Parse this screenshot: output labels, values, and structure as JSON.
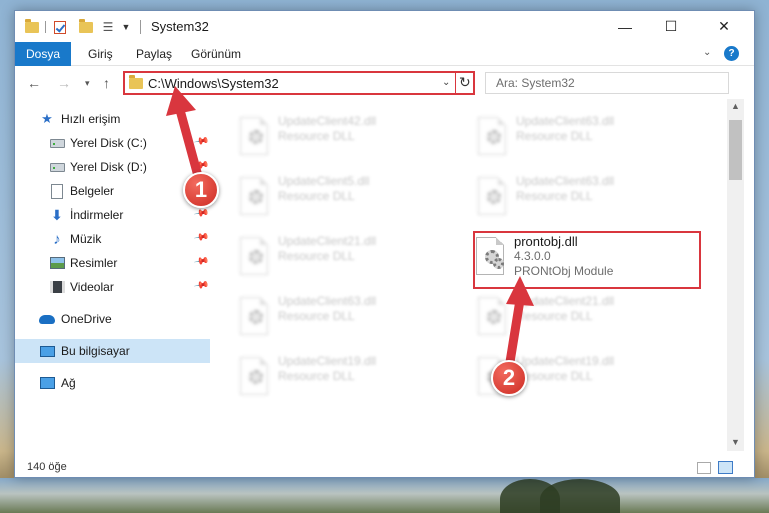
{
  "window": {
    "title": "System32",
    "colors": {
      "accent": "#1979ca",
      "annotation": "#d9363e",
      "selected": "#cce4f7"
    }
  },
  "ribbon": {
    "tabs": [
      "Dosya",
      "Giriş",
      "Paylaş",
      "Görünüm"
    ],
    "help_label": "?"
  },
  "navigation": {
    "address": "C:\\Windows\\System32",
    "search_placeholder": "Ara: System32"
  },
  "sidebar": {
    "items": [
      {
        "label": "Hızlı erişim",
        "icon": "star-icon",
        "pinned": false
      },
      {
        "label": "Yerel Disk (C:)",
        "icon": "drive-icon",
        "pinned": true
      },
      {
        "label": "Yerel Disk (D:)",
        "icon": "drive-icon",
        "pinned": true
      },
      {
        "label": "Belgeler",
        "icon": "document-icon",
        "pinned": true
      },
      {
        "label": "İndirmeler",
        "icon": "download-icon",
        "pinned": true
      },
      {
        "label": "Müzik",
        "icon": "music-icon",
        "pinned": true
      },
      {
        "label": "Resimler",
        "icon": "pictures-icon",
        "pinned": true
      },
      {
        "label": "Videolar",
        "icon": "videos-icon",
        "pinned": true
      },
      {
        "label": "OneDrive",
        "icon": "onedrive-icon",
        "pinned": false
      },
      {
        "label": "Bu bilgisayar",
        "icon": "this-pc-icon",
        "pinned": false,
        "selected": true
      },
      {
        "label": "Ağ",
        "icon": "network-icon",
        "pinned": false
      }
    ]
  },
  "files": [
    {
      "name": "UpdateClient42.dll",
      "type": "Resource DLL",
      "blurred": true
    },
    {
      "name": "UpdateClient63.dll",
      "type": "Resource DLL",
      "blurred": true
    },
    {
      "name": "UpdateClient5.dll",
      "type": "Resource DLL",
      "blurred": true
    },
    {
      "name": "UpdateClient63.dll",
      "type": "Resource DLL",
      "blurred": true
    },
    {
      "name": "UpdateClient21.dll",
      "type": "Resource DLL",
      "blurred": true
    },
    {
      "name": "prontobj.dll",
      "version": "4.3.0.0",
      "type": "PRONtObj Module",
      "blurred": false,
      "highlighted": true
    },
    {
      "name": "UpdateClient63.dll",
      "type": "Resource DLL",
      "blurred": true
    },
    {
      "name": "UpdateClient21.dll",
      "type": "Resource DLL",
      "blurred": true
    },
    {
      "name": "UpdateClient19.dll",
      "type": "Resource DLL",
      "blurred": true
    },
    {
      "name": "UpdateClient19.dll",
      "type": "Resource DLL",
      "blurred": true
    }
  ],
  "status": {
    "item_count": "140 öğe"
  },
  "annotations": [
    {
      "number": "1"
    },
    {
      "number": "2"
    }
  ]
}
